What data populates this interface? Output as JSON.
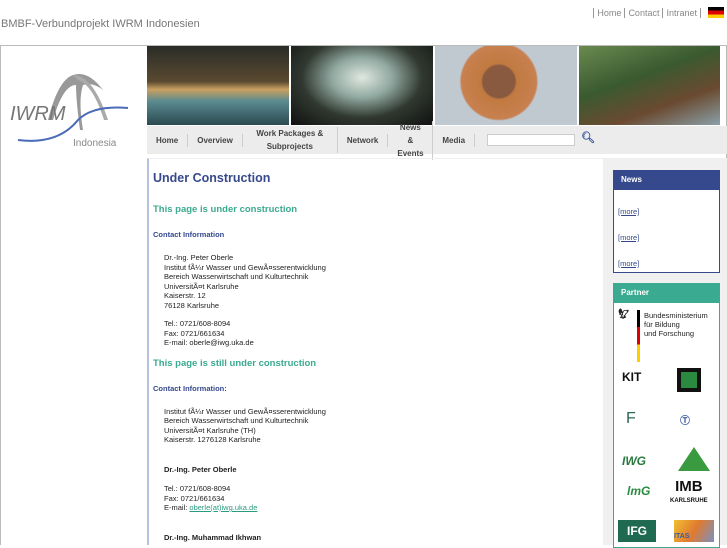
{
  "header": {
    "site_title": "BMBF-Verbundprojekt IWRM Indonesien",
    "links": [
      "Home",
      "Contact",
      "Intranet"
    ]
  },
  "logo": {
    "text": "IWRM",
    "sub": "Indonesia"
  },
  "nav": {
    "items": [
      "Home",
      "Overview",
      "Work Packages & Subprojects",
      "Network",
      "News & Events",
      "Media"
    ],
    "search_placeholder": ""
  },
  "content": {
    "title": "Under Construction",
    "s1_heading": "This page is under construction",
    "s1_contact": "Contact Information",
    "s1_lines": [
      "Dr.-Ing. Peter Oberle",
      "Institut fÃ¼r Wasser und GewÃ¤sserentwicklung",
      "Bereich Wasserwirtschaft und Kulturtechnik",
      "UniversitÃ¤t Karlsruhe",
      "Kaiserstr. 12",
      "76128 Karlsruhe"
    ],
    "s1_phone": [
      "Tel.: 0721/608-8094",
      "Fax: 0721/661634",
      "E-mail: oberle@iwg.uka.de"
    ],
    "s2_heading": "This page is still under construction",
    "s2_contact": "Contact Information:",
    "s2_lines": [
      "Institut fÃ¼r Wasser und GewÃ¤sserentwicklung",
      "Bereich Wasserwirtschaft und Kulturtechnik",
      "UniversitÃ¤t Karlsruhe (TH)",
      "Kaiserstr. 1276128 Karlsruhe"
    ],
    "s2_person": "Dr.-Ing. Peter Oberle",
    "s2_phone": [
      "Tel.: 0721/608-8094",
      "Fax: 0721/661634"
    ],
    "s2_email_label": "E-mail: ",
    "s2_email": "oberle(at)iwg.uka.de",
    "s2_person2": "Dr.-Ing. Muhammad Ikhwan"
  },
  "news": {
    "title": "News",
    "more": [
      "[more]",
      "[more]",
      "[more]"
    ]
  },
  "partner": {
    "title": "Partner",
    "bmbf": [
      "Bundesministerium",
      "für Bildung",
      "und Forschung"
    ],
    "logos": [
      "KIT",
      "IWG",
      "IMB",
      "KARLSRUHE",
      "IFG",
      "ITAS"
    ]
  }
}
